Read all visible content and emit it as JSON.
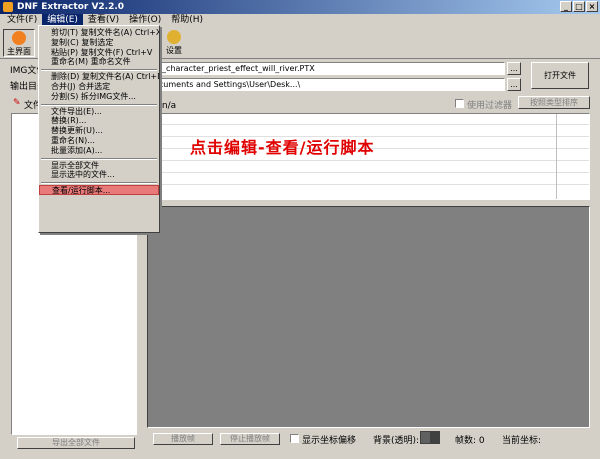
{
  "window": {
    "title": "DNF Extractor V2.2.0",
    "min": "_",
    "max": "□",
    "close": "×"
  },
  "menubar": [
    "文件(F)",
    "编辑(E)",
    "查看(V)",
    "操作(O)",
    "帮助(H)"
  ],
  "toolbar": {
    "open_label": "主界面",
    "right_label": "设置"
  },
  "form": {
    "file_label": "IMG文件:",
    "file_value": "te_character_priest_effect_will_river.PTX",
    "dir_label": "输出目录:",
    "dir_value": "ocuments and Settings\\User\\Desk...\\",
    "browse1": "...",
    "browse2": "...",
    "open_file_button": "打开文件",
    "list_label": "文件列表",
    "status_text": "字: n/a",
    "filter_label": "使用过滤器",
    "filter_button": "按照类型排序"
  },
  "annotation": "点击编辑-查看/运行脚本",
  "edit_menu": [
    "剪切(T)   复制文件名(A)   Ctrl+X",
    "复制(C)   复制选定",
    "粘贴(P)   复制文件(F) Ctrl+V",
    "重命名(M)   重命名文件",
    "-",
    "删除(D)   复制文件名(A) Ctrl+D",
    "合并(J)   合并选定",
    "分割(S)   拆分IMG文件...",
    "-",
    "文件导出(E)...",
    "替换(R)...",
    "替换更新(U)...",
    "重命名(N)...",
    "批量添加(A)...",
    "-",
    "显示全部文件",
    "显示选中的文件...",
    "-",
    "查看/运行脚本..."
  ],
  "bottombar": {
    "export_all_button": "导出全部文件",
    "play_button": "播放帧",
    "stop_button": "停止播放帧",
    "offset_label": "显示坐标偏移",
    "bg_label": "背景(透明):",
    "frame_label": "帧数: 0",
    "current_label": "当前坐标:"
  }
}
